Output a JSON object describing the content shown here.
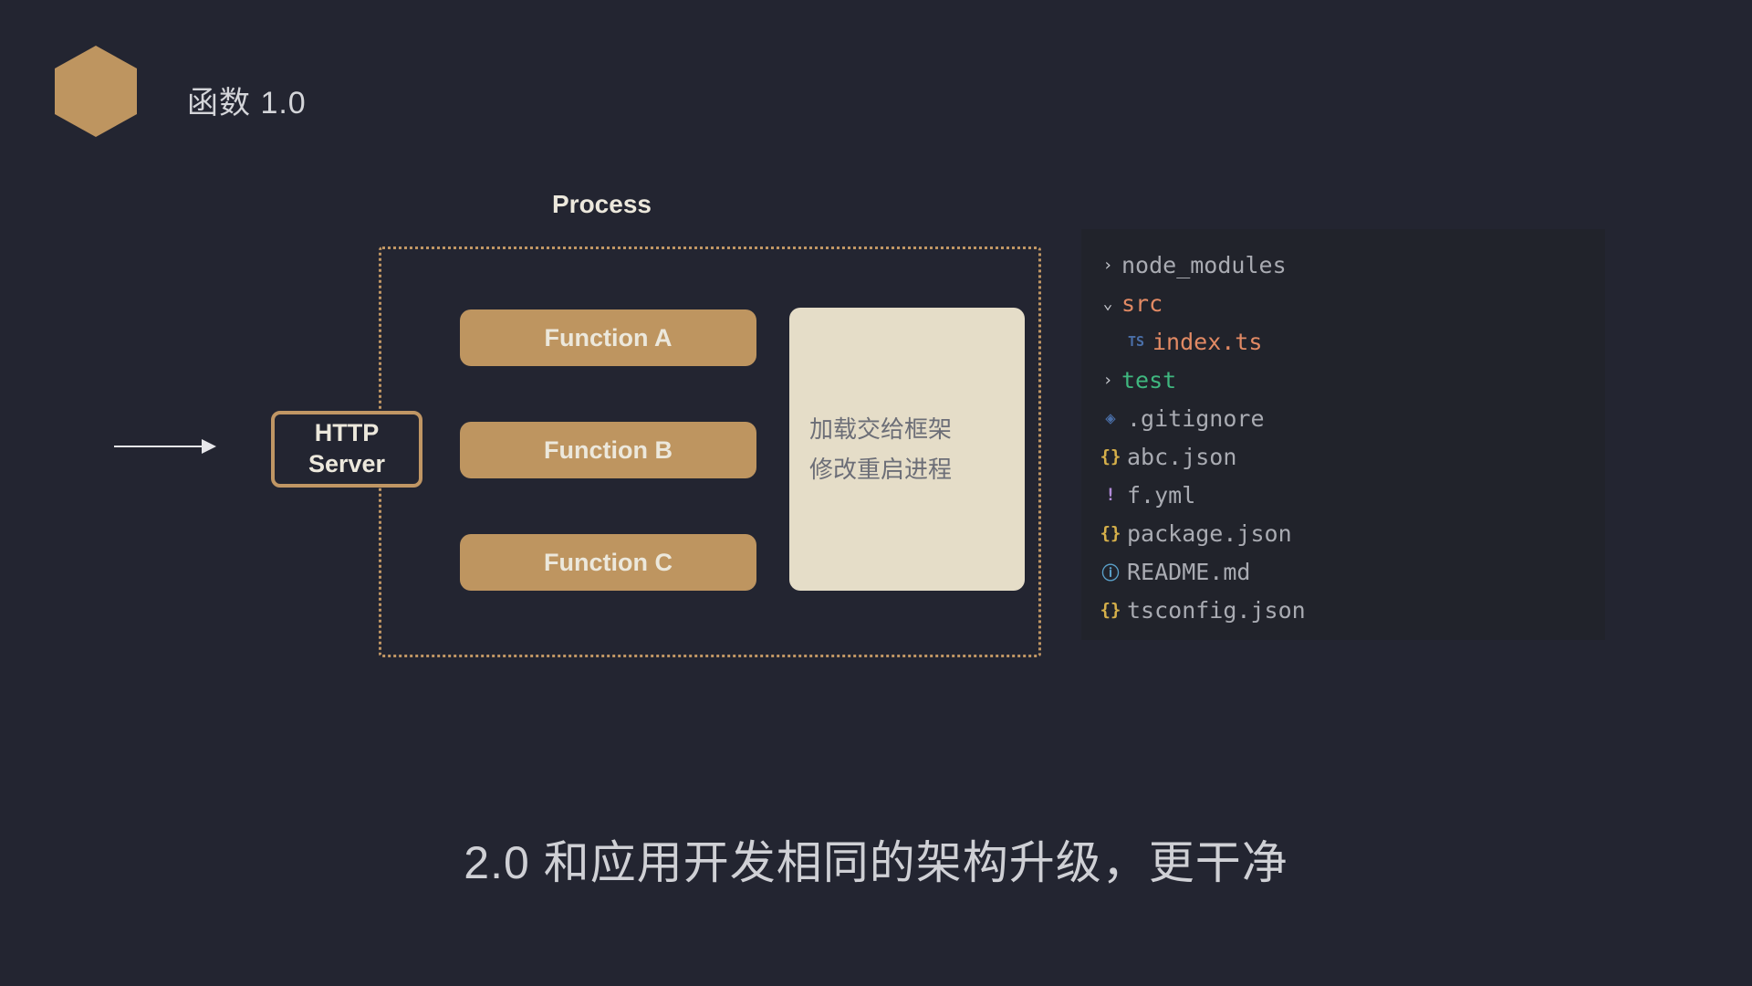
{
  "title": "函数 1.0",
  "process_label": "Process",
  "http_server": "HTTP\nServer",
  "functions": {
    "a": "Function A",
    "b": "Function B",
    "c": "Function C"
  },
  "side_panel": {
    "line1": "加载交给框架",
    "line2": "修改重启进程"
  },
  "tree": {
    "node_modules": "node_modules",
    "src": "src",
    "index_ts": "index.ts",
    "test": "test",
    "gitignore": ".gitignore",
    "abc_json": "abc.json",
    "f_yml": "f.yml",
    "package_json": "package.json",
    "readme": "README.md",
    "tsconfig": "tsconfig.json",
    "ts_badge": "TS"
  },
  "footer": "2.0 和应用开发相同的架构升级，更干净"
}
